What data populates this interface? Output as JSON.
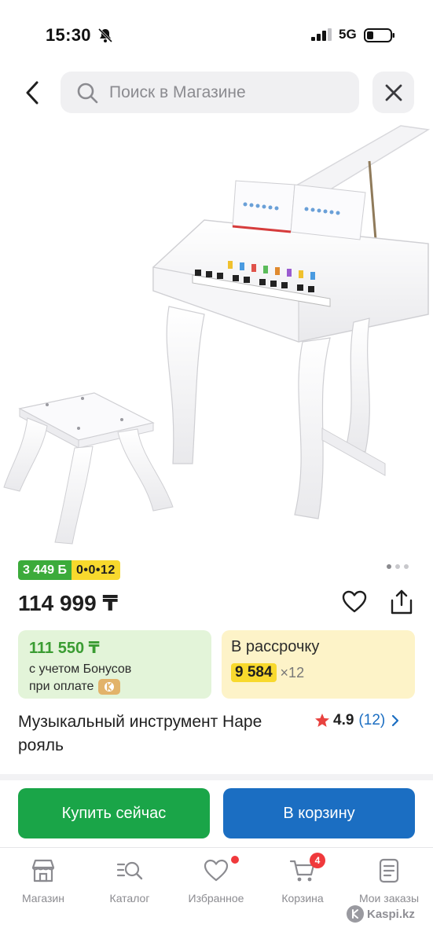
{
  "status_bar": {
    "time": "15:30",
    "network": "5G",
    "icons": [
      "bell-off-icon",
      "signal-icon",
      "battery-icon"
    ]
  },
  "header": {
    "search_placeholder": "Поиск в Магазине",
    "back_icon": "chevron-left-icon",
    "close_icon": "close-icon"
  },
  "gallery": {
    "pages": 3,
    "current_page": 1
  },
  "badges": {
    "bonus": "3 449 Б",
    "installment": "0•0•12"
  },
  "product": {
    "price": "114 999 ₸",
    "title": "Музыкальный инструмент Hape рояль",
    "rating": "4.9",
    "reviews": "(12)"
  },
  "offers": {
    "bonus": {
      "price": "111 550 ₸",
      "line1": "с учетом Бонусов",
      "line2": "при оплате"
    },
    "installment": {
      "title": "В рассрочку",
      "amount": "9 584",
      "months": "×12"
    }
  },
  "actions": {
    "buy_now": "Купить сейчас",
    "add_to_cart": "В корзину"
  },
  "nav": {
    "items": [
      {
        "label": "Магазин",
        "icon": "store-icon"
      },
      {
        "label": "Каталог",
        "icon": "catalog-search-icon"
      },
      {
        "label": "Избранное",
        "icon": "heart-icon",
        "dot": true
      },
      {
        "label": "Корзина",
        "icon": "cart-icon",
        "badge": "4"
      },
      {
        "label": "Мои заказы",
        "icon": "orders-icon"
      }
    ]
  },
  "watermark": "Kaspi.kz",
  "colors": {
    "green": "#1aa548",
    "blue": "#1b6ec2",
    "yellow": "#f8d92d",
    "bonus_green": "#3cab3b",
    "red": "#f0393c"
  }
}
